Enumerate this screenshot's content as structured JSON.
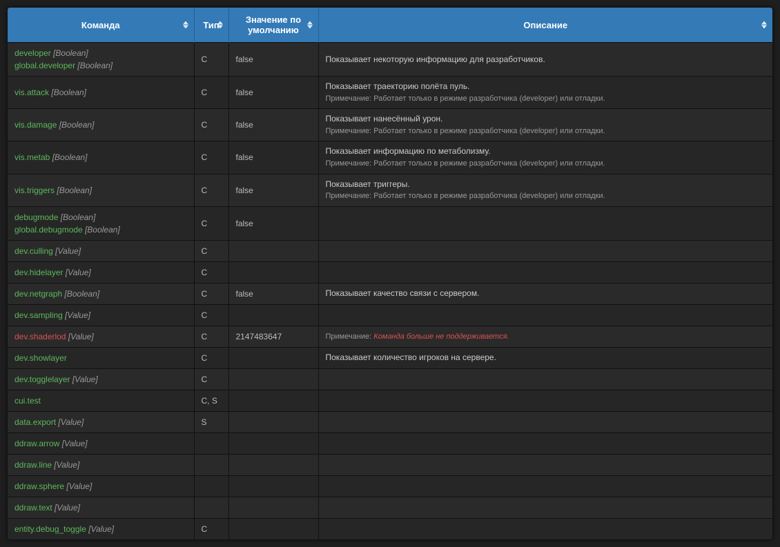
{
  "headers": {
    "command": "Команда",
    "type": "Тип",
    "default": "Значение по умолчанию",
    "description": "Описание"
  },
  "note_label": "Примечание:",
  "rows": [
    {
      "commands": [
        {
          "name": "developer",
          "param": "[Boolean]",
          "deprecated": false
        },
        {
          "name": "global.developer",
          "param": "[Boolean]",
          "deprecated": false
        }
      ],
      "type": "C",
      "default": "false",
      "desc": "Показывает некоторую информацию для разработчиков.",
      "note": "",
      "note_deprecated": false
    },
    {
      "commands": [
        {
          "name": "vis.attack",
          "param": "[Boolean]",
          "deprecated": false
        }
      ],
      "type": "C",
      "default": "false",
      "desc": "Показывает траекторию полёта пуль.",
      "note": "Работает только в режиме разработчика (developer) или отладки.",
      "note_deprecated": false
    },
    {
      "commands": [
        {
          "name": "vis.damage",
          "param": "[Boolean]",
          "deprecated": false
        }
      ],
      "type": "C",
      "default": "false",
      "desc": "Показывает нанесённый урон.",
      "note": "Работает только в режиме разработчика (developer) или отладки.",
      "note_deprecated": false
    },
    {
      "commands": [
        {
          "name": "vis.metab",
          "param": "[Boolean]",
          "deprecated": false
        }
      ],
      "type": "C",
      "default": "false",
      "desc": "Показывает информацию по метаболизму.",
      "note": "Работает только в режиме разработчика (developer) или отладки.",
      "note_deprecated": false
    },
    {
      "commands": [
        {
          "name": "vis.triggers",
          "param": "[Boolean]",
          "deprecated": false
        }
      ],
      "type": "C",
      "default": "false",
      "desc": "Показывает триггеры.",
      "note": "Работает только в режиме разработчика (developer) или отладки.",
      "note_deprecated": false
    },
    {
      "commands": [
        {
          "name": "debugmode",
          "param": "[Boolean]",
          "deprecated": false
        },
        {
          "name": "global.debugmode",
          "param": "[Boolean]",
          "deprecated": false
        }
      ],
      "type": "C",
      "default": "false",
      "desc": "",
      "note": "",
      "note_deprecated": false
    },
    {
      "commands": [
        {
          "name": "dev.culling",
          "param": "[Value]",
          "deprecated": false
        }
      ],
      "type": "C",
      "default": "",
      "desc": "",
      "note": "",
      "note_deprecated": false
    },
    {
      "commands": [
        {
          "name": "dev.hidelayer",
          "param": "[Value]",
          "deprecated": false
        }
      ],
      "type": "C",
      "default": "",
      "desc": "",
      "note": "",
      "note_deprecated": false
    },
    {
      "commands": [
        {
          "name": "dev.netgraph",
          "param": "[Boolean]",
          "deprecated": false
        }
      ],
      "type": "C",
      "default": "false",
      "desc": "Показывает качество связи с сервером.",
      "note": "",
      "note_deprecated": false
    },
    {
      "commands": [
        {
          "name": "dev.sampling",
          "param": "[Value]",
          "deprecated": false
        }
      ],
      "type": "C",
      "default": "",
      "desc": "",
      "note": "",
      "note_deprecated": false
    },
    {
      "commands": [
        {
          "name": "dev.shaderlod",
          "param": "[Value]",
          "deprecated": true
        }
      ],
      "type": "C",
      "default": "2147483647",
      "desc": "",
      "note": "Команда больше не поддерживается.",
      "note_deprecated": true
    },
    {
      "commands": [
        {
          "name": "dev.showlayer",
          "param": "",
          "deprecated": false
        }
      ],
      "type": "C",
      "default": "",
      "desc": "Показывает количество игроков на сервере.",
      "note": "",
      "note_deprecated": false
    },
    {
      "commands": [
        {
          "name": "dev.togglelayer",
          "param": "[Value]",
          "deprecated": false
        }
      ],
      "type": "C",
      "default": "",
      "desc": "",
      "note": "",
      "note_deprecated": false
    },
    {
      "commands": [
        {
          "name": "cui.test",
          "param": "",
          "deprecated": false
        }
      ],
      "type": "C, S",
      "default": "",
      "desc": "",
      "note": "",
      "note_deprecated": false
    },
    {
      "commands": [
        {
          "name": "data.export",
          "param": "[Value]",
          "deprecated": false
        }
      ],
      "type": "S",
      "default": "",
      "desc": "",
      "note": "",
      "note_deprecated": false
    },
    {
      "commands": [
        {
          "name": "ddraw.arrow",
          "param": "[Value]",
          "deprecated": false
        }
      ],
      "type": "",
      "default": "",
      "desc": "",
      "note": "",
      "note_deprecated": false
    },
    {
      "commands": [
        {
          "name": "ddraw.line",
          "param": "[Value]",
          "deprecated": false
        }
      ],
      "type": "",
      "default": "",
      "desc": "",
      "note": "",
      "note_deprecated": false
    },
    {
      "commands": [
        {
          "name": "ddraw.sphere",
          "param": "[Value]",
          "deprecated": false
        }
      ],
      "type": "",
      "default": "",
      "desc": "",
      "note": "",
      "note_deprecated": false
    },
    {
      "commands": [
        {
          "name": "ddraw.text",
          "param": "[Value]",
          "deprecated": false
        }
      ],
      "type": "",
      "default": "",
      "desc": "",
      "note": "",
      "note_deprecated": false
    },
    {
      "commands": [
        {
          "name": "entity.debug_toggle",
          "param": "[Value]",
          "deprecated": false
        }
      ],
      "type": "C",
      "default": "",
      "desc": "",
      "note": "",
      "note_deprecated": false
    }
  ]
}
